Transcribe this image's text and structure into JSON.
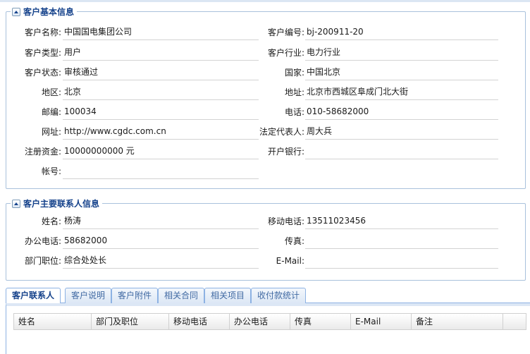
{
  "basic_info": {
    "title": "客户基本信息",
    "fields": {
      "name": {
        "label": "客户名称:",
        "value": "中国国电集团公司"
      },
      "code": {
        "label": "客户编号:",
        "value": "bj-200911-20"
      },
      "type": {
        "label": "客户类型:",
        "value": "用户"
      },
      "industry": {
        "label": "客户行业:",
        "value": "电力行业"
      },
      "status": {
        "label": "客户状态:",
        "value": "审核通过"
      },
      "country": {
        "label": "国家:",
        "value": "中国北京"
      },
      "region": {
        "label": "地区:",
        "value": "北京"
      },
      "address": {
        "label": "地址:",
        "value": "北京市西城区阜成门北大街"
      },
      "postcode": {
        "label": "邮编:",
        "value": "100034"
      },
      "phone": {
        "label": "电话:",
        "value": "010-58682000"
      },
      "website": {
        "label": "网址:",
        "value": "http://www.cgdc.com.cn"
      },
      "legal_rep": {
        "label": "法定代表人:",
        "value": "周大兵"
      },
      "capital": {
        "label": "注册资金:",
        "value": "10000000000 元"
      },
      "bank": {
        "label": "开户银行:",
        "value": ""
      },
      "account": {
        "label": "帐号:",
        "value": ""
      }
    }
  },
  "contact_info": {
    "title": "客户主要联系人信息",
    "fields": {
      "name": {
        "label": "姓名:",
        "value": "杨涛"
      },
      "mobile": {
        "label": "移动电话:",
        "value": "13511023456"
      },
      "office_phone": {
        "label": "办公电话:",
        "value": "58682000"
      },
      "fax": {
        "label": "传真:",
        "value": ""
      },
      "position": {
        "label": "部门职位:",
        "value": "综合处处长"
      },
      "email": {
        "label": "E-Mail:",
        "value": ""
      }
    }
  },
  "tabs": [
    {
      "label": "客户联系人",
      "active": true
    },
    {
      "label": "客户说明",
      "active": false
    },
    {
      "label": "客户附件",
      "active": false
    },
    {
      "label": "相关合同",
      "active": false
    },
    {
      "label": "相关项目",
      "active": false
    },
    {
      "label": "收付款统计",
      "active": false
    }
  ],
  "grid": {
    "columns": [
      "姓名",
      "部门及职位",
      "移动电话",
      "办公电话",
      "传真",
      "E-Mail",
      "备注"
    ]
  },
  "colors": {
    "border": "#a9c1dc",
    "title": "#15428b",
    "tab_text": "#416aa3"
  }
}
